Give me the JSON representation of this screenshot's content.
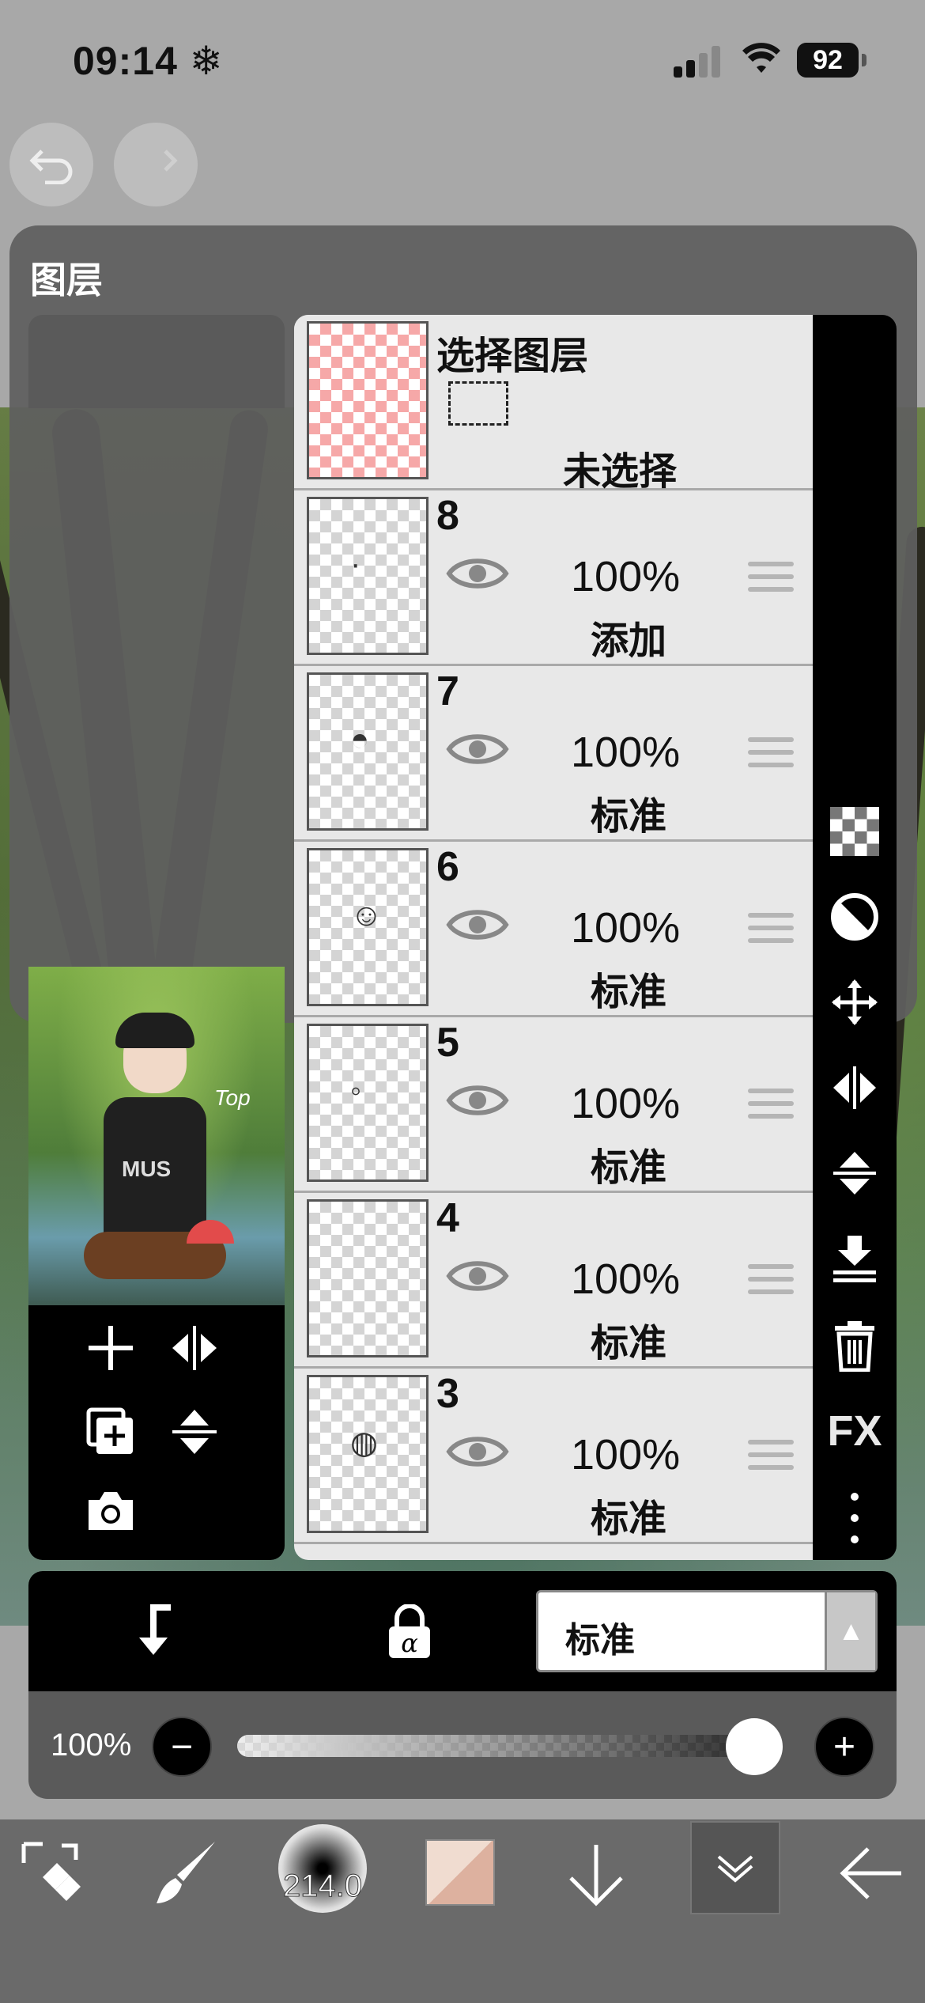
{
  "status_bar": {
    "time": "09:14",
    "time_icon": "snowflake-icon",
    "battery": "92"
  },
  "panel": {
    "title": "图层"
  },
  "selection_layer": {
    "title": "选择图层",
    "state": "未选择"
  },
  "layers": [
    {
      "number": "8",
      "opacity": "100%",
      "blend": "添加"
    },
    {
      "number": "7",
      "opacity": "100%",
      "blend": "标准"
    },
    {
      "number": "6",
      "opacity": "100%",
      "blend": "标准"
    },
    {
      "number": "5",
      "opacity": "100%",
      "blend": "标准"
    },
    {
      "number": "4",
      "opacity": "100%",
      "blend": "标准"
    },
    {
      "number": "3",
      "opacity": "100%",
      "blend": "标准"
    }
  ],
  "right_tools": [
    "checker-icon",
    "clip-icon",
    "move-icon",
    "flip-horizontal-icon",
    "flip-vertical-icon",
    "merge-down-icon",
    "trash-icon",
    "FX",
    "more-vertical-icon"
  ],
  "layer_controls": {
    "blend_mode": "标准",
    "opacity_label": "100%",
    "opacity_value": 1.0
  },
  "preview": {
    "shirt_text": "MUS",
    "sign_text": "Top"
  },
  "toolbar": {
    "brush_size": "214.0"
  },
  "colors": {
    "accent_pink": "#f6a8a8",
    "swatch_light": "#f0dcd0",
    "swatch_dark": "#ddb19f"
  }
}
